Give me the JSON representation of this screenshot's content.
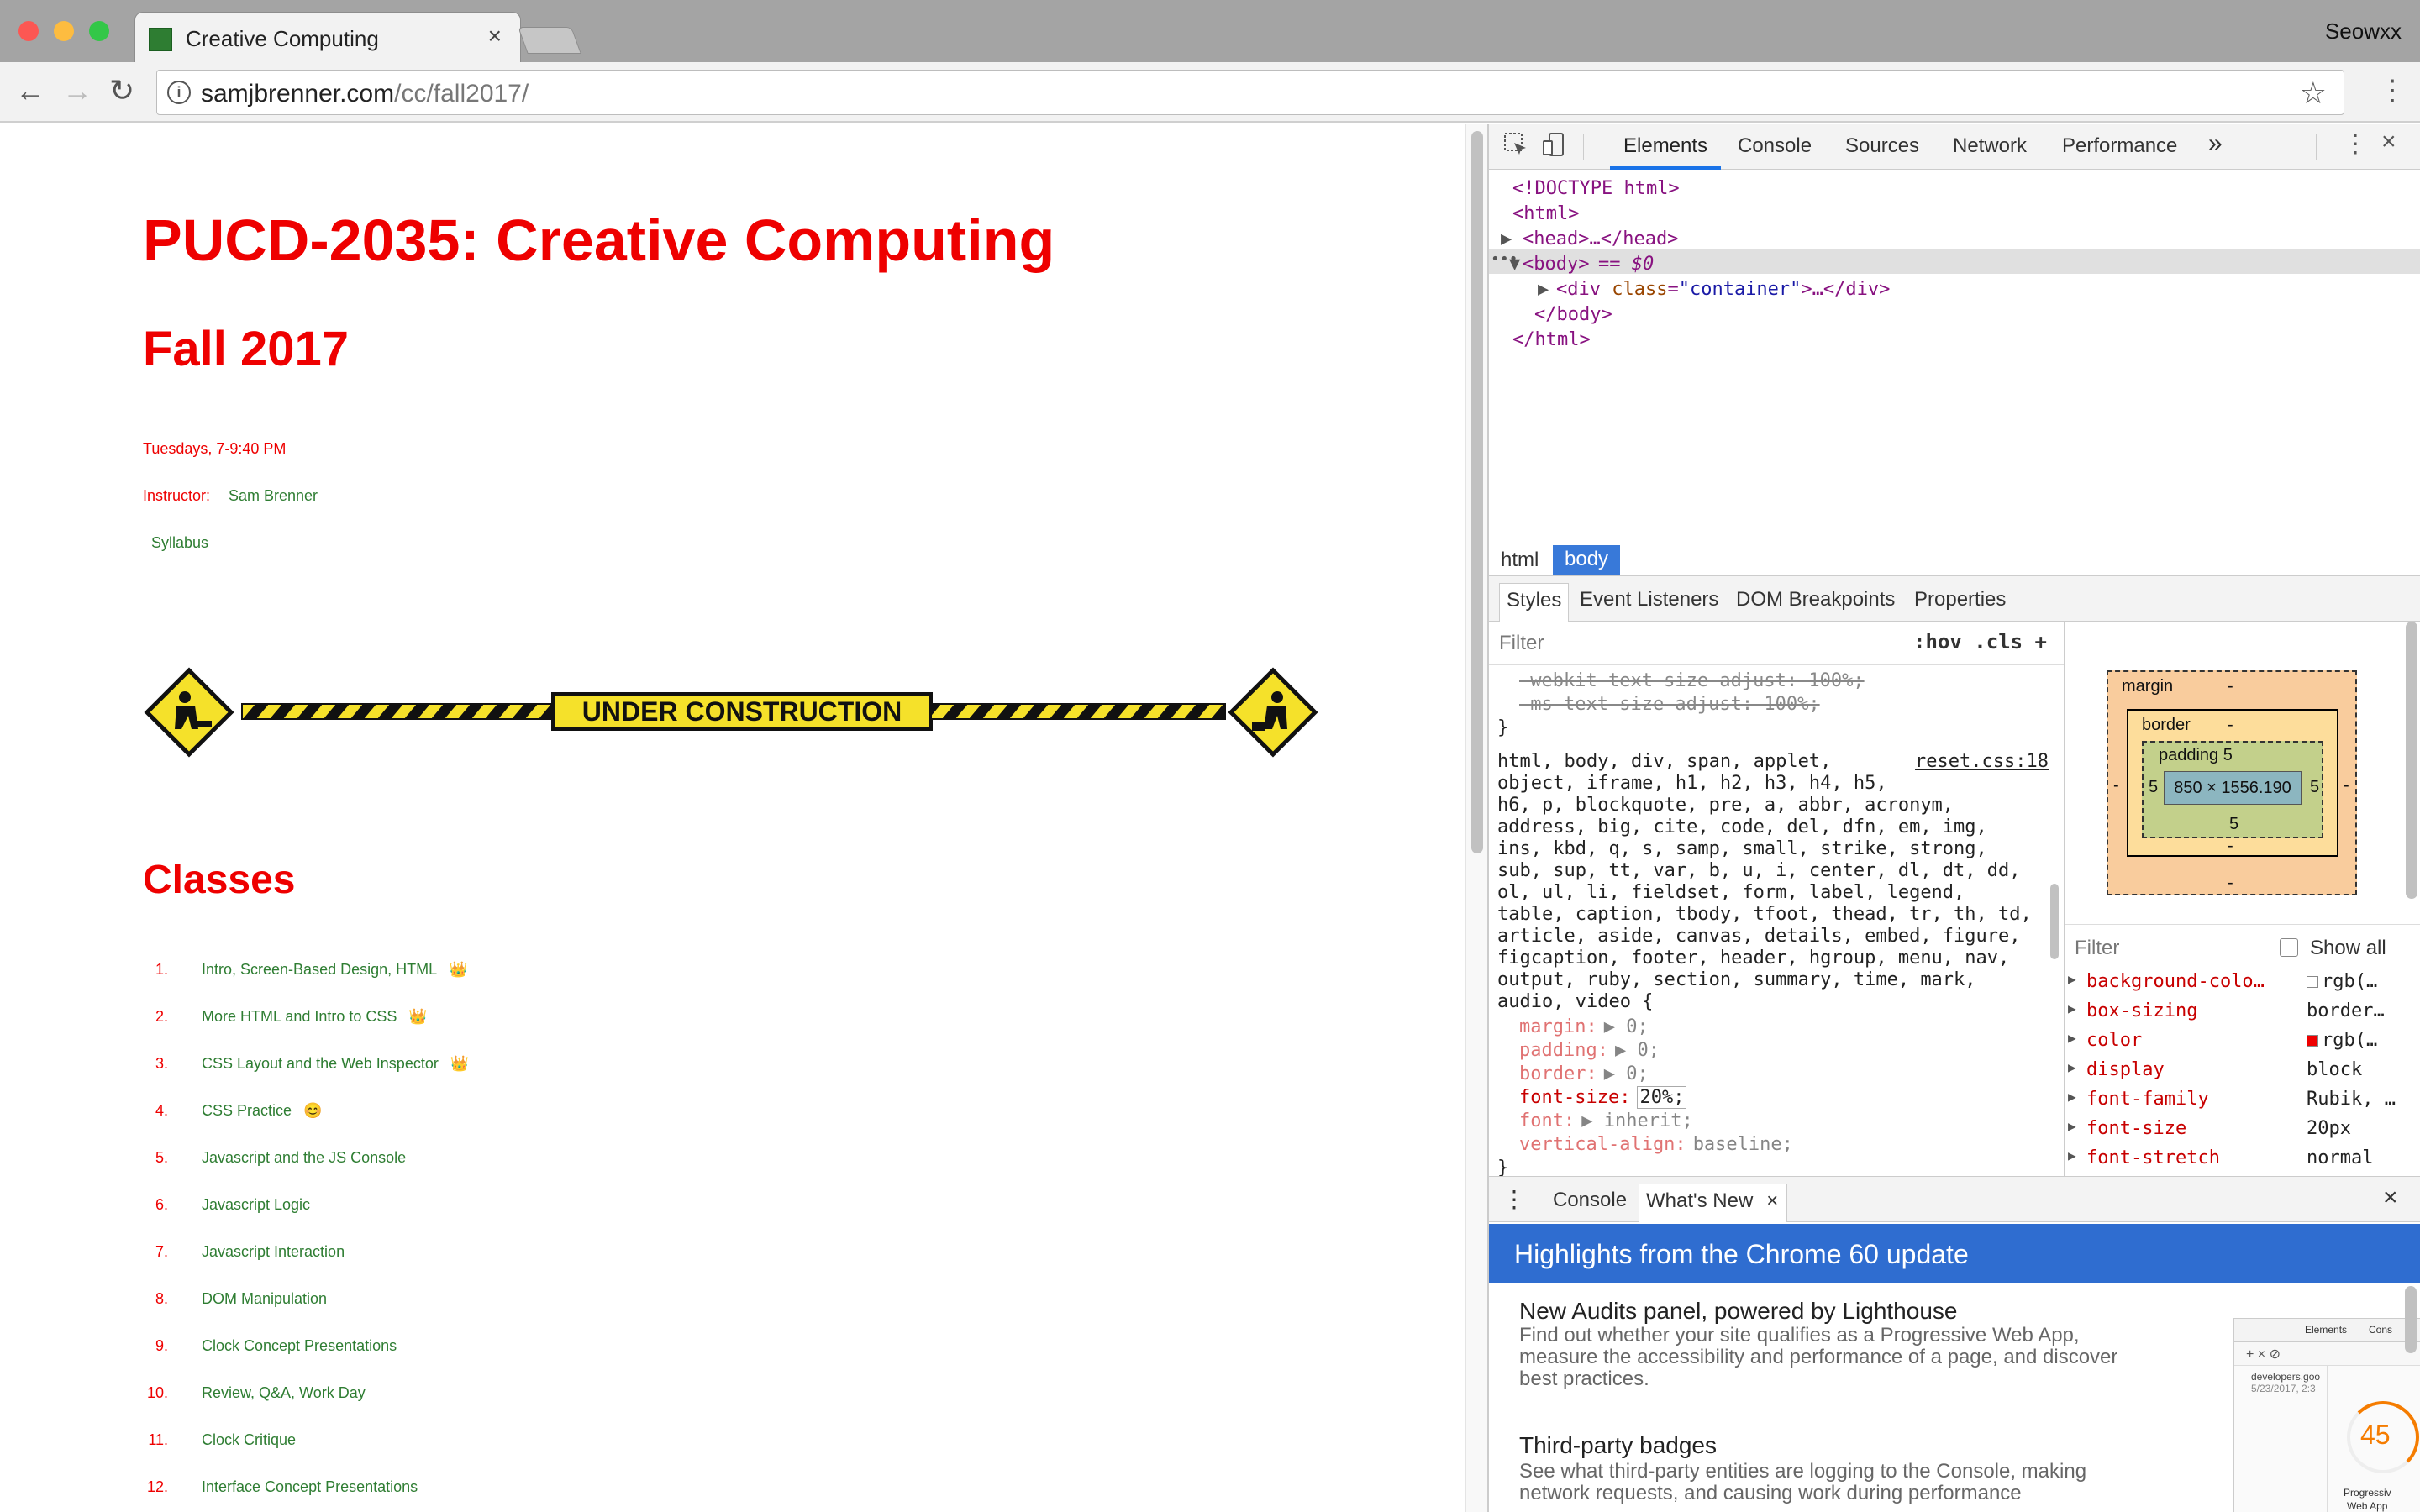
{
  "browser": {
    "tab_title": "Creative Computing",
    "profile": "Seowxx",
    "url_host": "samjbrenner.com",
    "url_path": "/cc/fall2017/"
  },
  "page": {
    "title": "PUCD-2035: Creative Computing",
    "term": "Fall 2017",
    "time": "Tuesdays, 7-9:40 PM",
    "instructor_label": "Instructor:",
    "instructor_name": "Sam Brenner",
    "syllabus": "Syllabus",
    "banner": "UNDER CONSTRUCTION",
    "classes_heading": "Classes",
    "classes": [
      {
        "n": "1.",
        "t": "Intro, Screen-Based Design, HTML",
        "emoji": "👑"
      },
      {
        "n": "2.",
        "t": "More HTML and Intro to CSS",
        "emoji": "👑"
      },
      {
        "n": "3.",
        "t": "CSS Layout and the Web Inspector",
        "emoji": "👑"
      },
      {
        "n": "4.",
        "t": "CSS Practice",
        "emoji": "😊"
      },
      {
        "n": "5.",
        "t": "Javascript and the JS Console",
        "emoji": ""
      },
      {
        "n": "6.",
        "t": "Javascript Logic",
        "emoji": ""
      },
      {
        "n": "7.",
        "t": "Javascript Interaction",
        "emoji": ""
      },
      {
        "n": "8.",
        "t": "DOM Manipulation",
        "emoji": ""
      },
      {
        "n": "9.",
        "t": "Clock Concept Presentations",
        "emoji": ""
      },
      {
        "n": "10.",
        "t": "Review, Q&A, Work Day",
        "emoji": ""
      },
      {
        "n": "11.",
        "t": "Clock Critique",
        "emoji": ""
      },
      {
        "n": "12.",
        "t": "Interface Concept Presentations",
        "emoji": ""
      }
    ]
  },
  "devtools": {
    "tabs": [
      "Elements",
      "Console",
      "Sources",
      "Network",
      "Performance"
    ],
    "more": "»",
    "dom": {
      "doctype": "<!DOCTYPE html>",
      "html_open": "<html>",
      "head": "<head>…</head>",
      "body_open": "<body>",
      "body_eq": "== $0",
      "div_tag": "<div",
      "div_attr": "class",
      "div_val": "\"container\"",
      "div_rest": ">…</div>",
      "body_close": "</body>",
      "html_close": "</html>"
    },
    "breadcrumbs": [
      "html",
      "body"
    ],
    "style_tabs": [
      "Styles",
      "Event Listeners",
      "DOM Breakpoints",
      "Properties"
    ],
    "filter_placeholder": "Filter",
    "filter_tools": ":hov  .cls  +",
    "rules": {
      "webkit": "-webkit-text-size-adjust: 100%;",
      "ms": "-ms-text-size-adjust: 100%;",
      "close": "}",
      "source": "reset.css:18",
      "selector_lines": [
        "html, body, div, span, applet,",
        "object, iframe, h1, h2, h3, h4, h5,",
        "h6, p, blockquote, pre, a, abbr, acronym,",
        "address, big, cite, code, del, dfn, em, img,",
        "ins, kbd, q, s, samp, small, strike, strong,",
        "sub, sup, tt, var, b, u, i, center, dl, dt, dd,",
        "ol, ul, li, fieldset, form, label, legend,",
        "table, caption, tbody, tfoot, thead, tr, th, td,",
        "article, aside, canvas, details, embed, figure,",
        "figcaption, footer, header, hgroup, menu, nav,",
        "output, ruby, section, summary, time, mark,",
        "audio, video {"
      ],
      "decls": [
        {
          "p": "margin:",
          "v": "▶ 0;",
          "dim": true
        },
        {
          "p": "padding:",
          "v": "▶ 0;",
          "dim": true
        },
        {
          "p": "border:",
          "v": "▶ 0;",
          "dim": true
        },
        {
          "p": "font-size:",
          "v": "20%;",
          "dim": false
        },
        {
          "p": "font:",
          "v": "▶ inherit;",
          "dim": true
        },
        {
          "p": "vertical-align:",
          "v": "baseline;",
          "dim": true
        }
      ]
    },
    "box": {
      "margin": "margin",
      "border": "border",
      "padding": "padding 5",
      "content": "850 × 1556.190",
      "dash": "-",
      "five": "5"
    },
    "computed_filter": "Filter",
    "show_all": "Show all",
    "computed": [
      {
        "p": "background-colo…",
        "v": "rgb(…",
        "swatch": "#ffffff"
      },
      {
        "p": "box-sizing",
        "v": "border…",
        "swatch": ""
      },
      {
        "p": "color",
        "v": "rgb(…",
        "swatch": "#ee0000"
      },
      {
        "p": "display",
        "v": "block",
        "swatch": ""
      },
      {
        "p": "font-family",
        "v": "Rubik, …",
        "swatch": ""
      },
      {
        "p": "font-size",
        "v": "20px",
        "swatch": ""
      },
      {
        "p": "font-stretch",
        "v": "normal",
        "swatch": ""
      }
    ],
    "drawer_tabs": [
      "Console",
      "What's New"
    ],
    "highlights": "Highlights from the Chrome 60 update",
    "news": [
      {
        "h": "New Audits panel, powered by Lighthouse",
        "p": "Find out whether your site qualifies as a Progressive Web App, measure the accessibility and performance of a page, and discover best practices."
      },
      {
        "h": "Third-party badges",
        "p": "See what third-party entities are logging to the Console, making network requests, and causing work during performance"
      }
    ],
    "thumb": {
      "tab1": "Elements",
      "tab2": "Cons",
      "site": "developers.goo",
      "date": "5/23/2017, 2:3",
      "score": "45",
      "label1": "Progressiv",
      "label2": "Web App"
    }
  },
  "colors": {
    "accent_red": "#ee0000",
    "link_green": "#2e7d32",
    "devtools_blue": "#1a73e8"
  }
}
